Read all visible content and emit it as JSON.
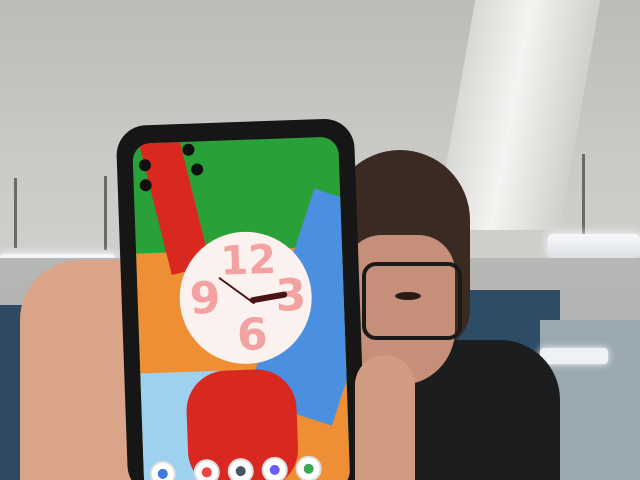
{
  "photo": {
    "description_visible_text": "",
    "phone": {
      "status_bar": {
        "time": "",
        "system_icons": ""
      },
      "clock_numbers": [
        "12",
        "3",
        "6",
        "9"
      ],
      "dock_apps": [
        "phone-app-icon",
        "messages-app-icon",
        "camera-app-icon",
        "messenger-app-icon",
        "chrome-app-icon"
      ]
    }
  },
  "colors": {
    "wallpaper_green": "#2aa038",
    "wallpaper_orange": "#ef8f35",
    "wallpaper_blue": "#4a8fe0",
    "wallpaper_red": "#d8281f",
    "clock_face": "#fbf1ee",
    "clock_numeral": "#f2a2a0"
  }
}
